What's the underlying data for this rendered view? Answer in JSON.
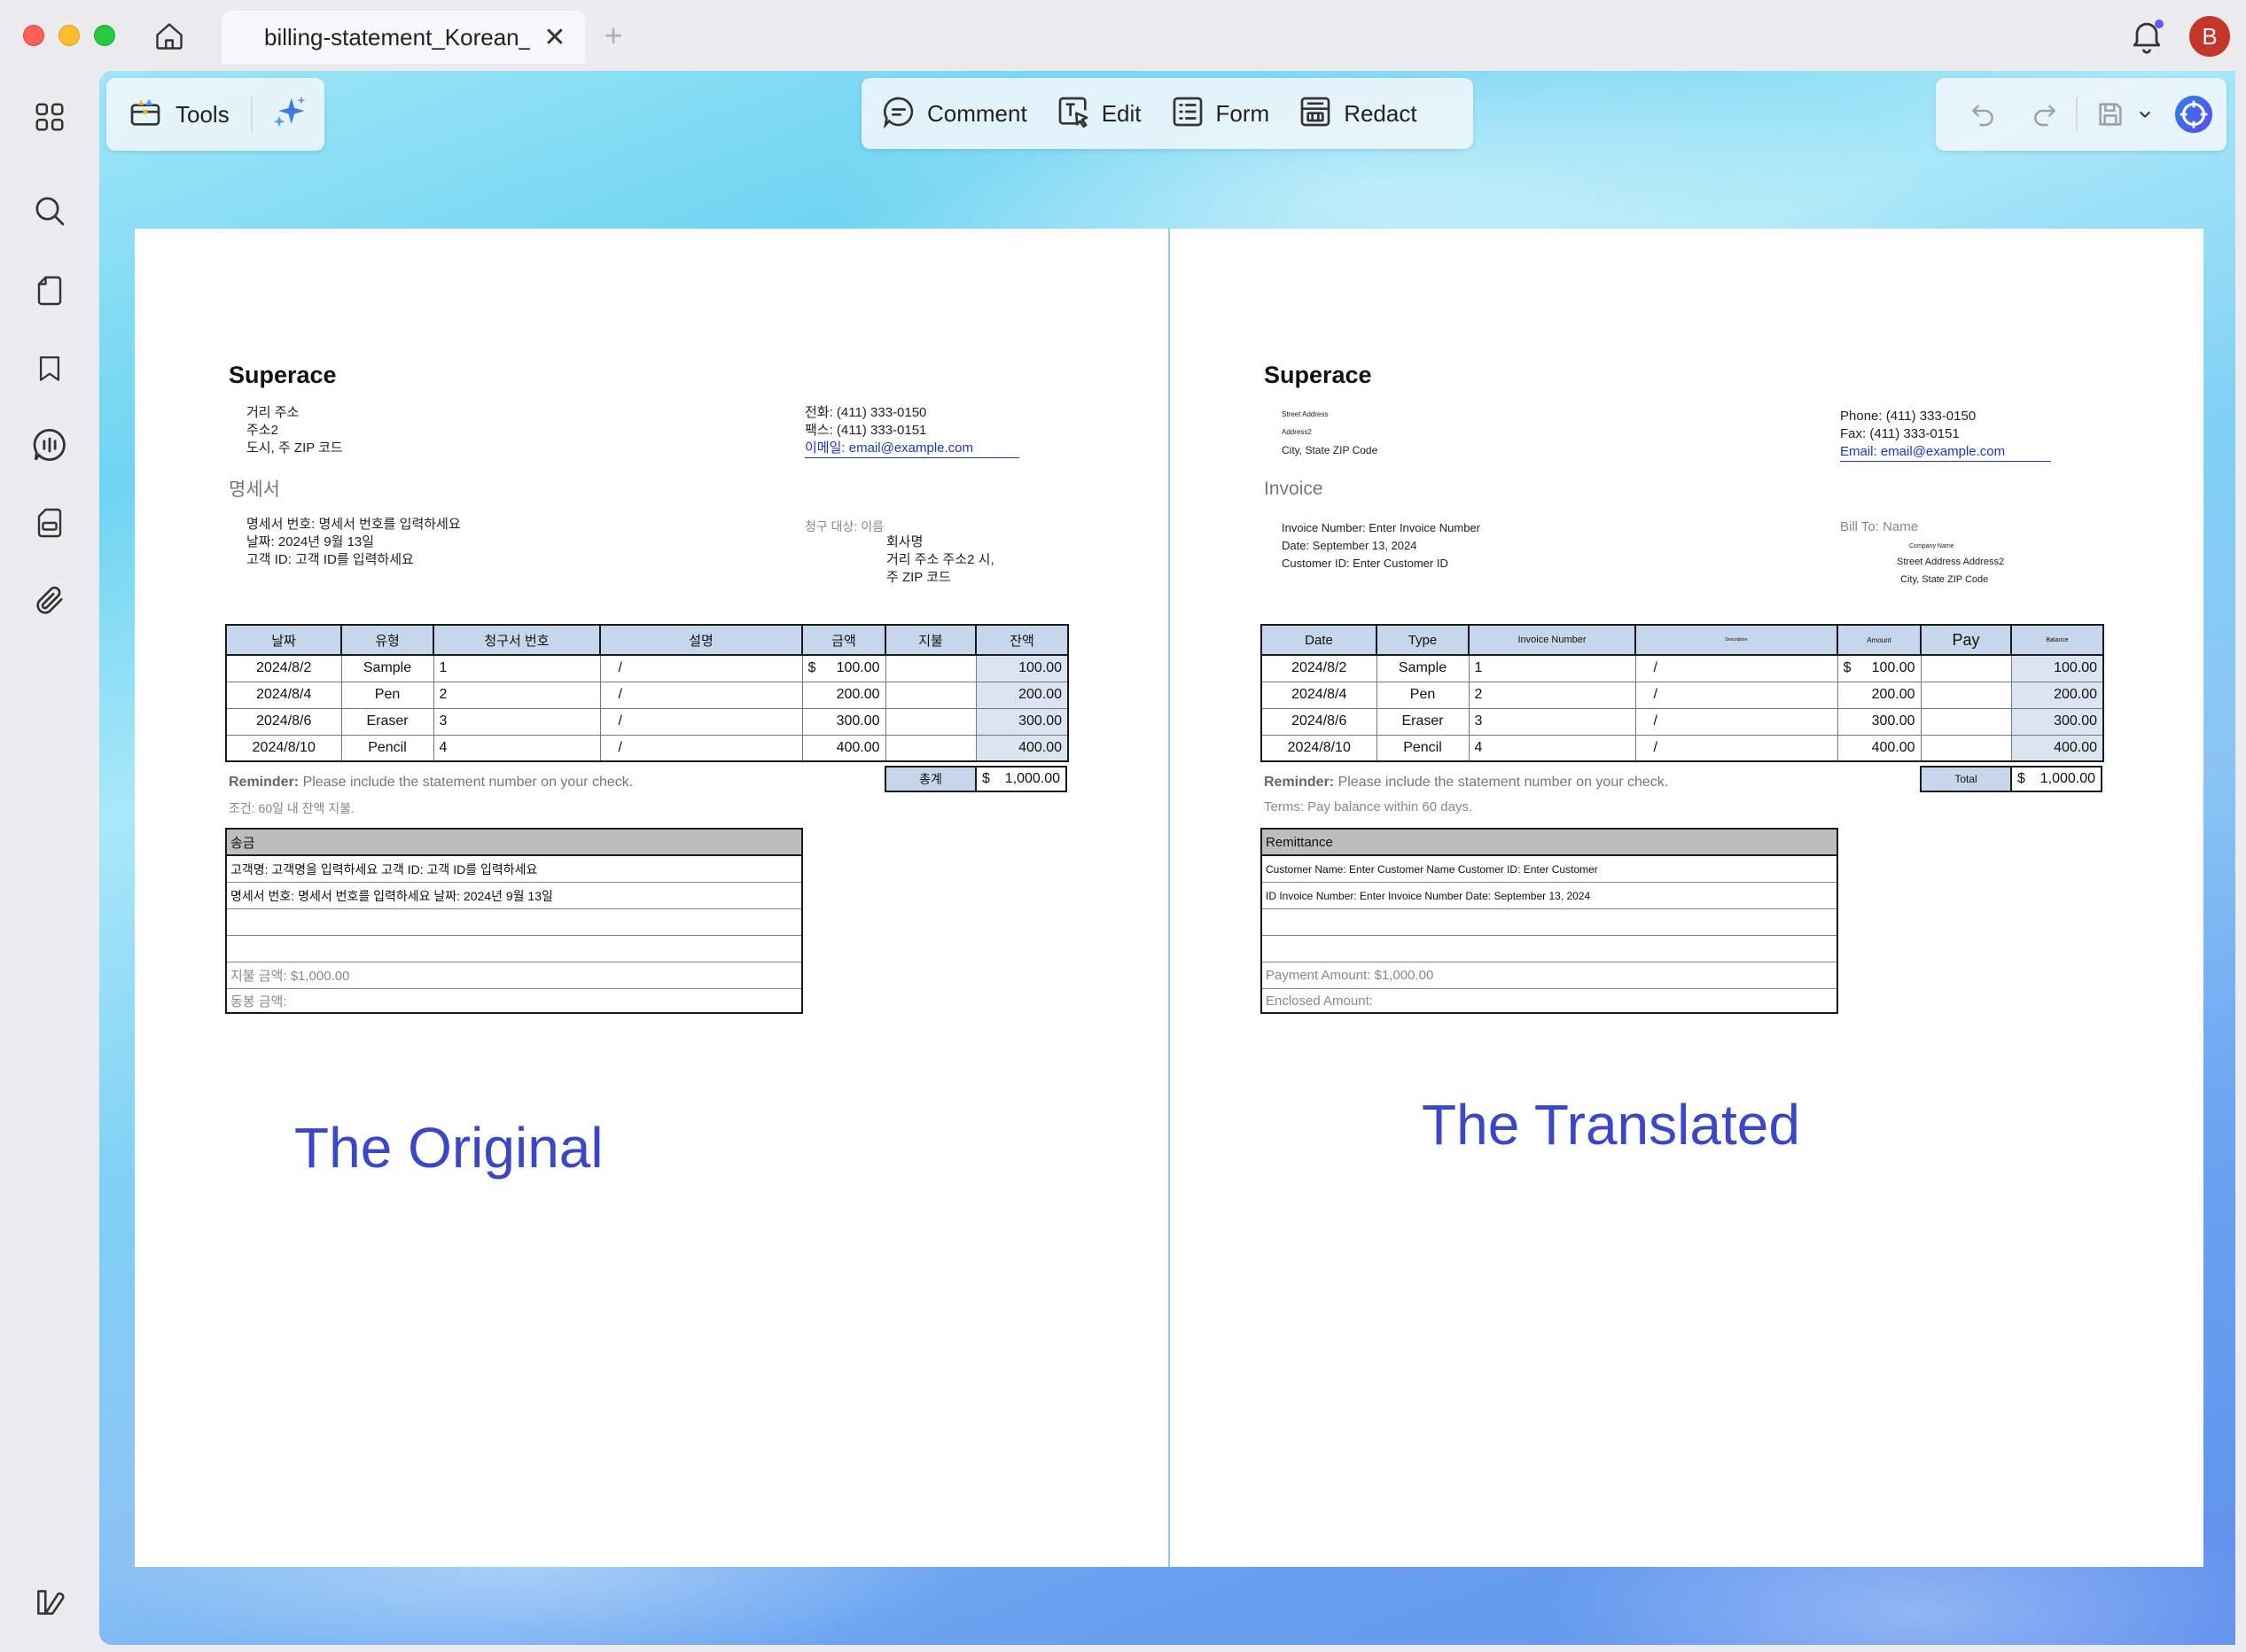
{
  "window": {
    "tab_title": "billing-statement_Korean_",
    "tab_close": "✕",
    "tab_add": "+",
    "avatar_initial": "B"
  },
  "toolbar": {
    "tools_label": "Tools",
    "comment_label": "Comment",
    "edit_label": "Edit",
    "form_label": "Form",
    "redact_label": "Redact"
  },
  "colors": {
    "accent": "#3a47c8",
    "table_header": "#c6d7ec",
    "avatar": "#c4352a",
    "link": "#1a37c9"
  },
  "original": {
    "company": "Superace",
    "address": [
      "거리 주소",
      "주소2",
      "도시, 주 ZIP 코드"
    ],
    "contact": {
      "phone": "전화: (411) 333-0150",
      "fax": "팩스: (411) 333-0151",
      "email_label": "이메일: ",
      "email": "email@example.com"
    },
    "heading": "명세서",
    "meta": [
      "명세서 번호: 명세서 번호를 입력하세요",
      "날짜: 2024년 9월 13일",
      "고객 ID: 고객 ID를 입력하세요"
    ],
    "bill_to_label": "청구 대상: 이름",
    "bill_to": [
      "회사명",
      "거리 주소 주소2 시,",
      "주 ZIP 코드"
    ],
    "headers": [
      "날짜",
      "유형",
      "청구서 번호",
      "설명",
      "금액",
      "지불",
      "잔액"
    ],
    "rows": [
      {
        "date": "2024/8/2",
        "type": "Sample",
        "invoice": "1",
        "desc": "/",
        "cur": "$",
        "amount": "100.00",
        "pay": "",
        "balance": "100.00"
      },
      {
        "date": "2024/8/4",
        "type": "Pen",
        "invoice": "2",
        "desc": "/",
        "cur": "",
        "amount": "200.00",
        "pay": "",
        "balance": "200.00"
      },
      {
        "date": "2024/8/6",
        "type": "Eraser",
        "invoice": "3",
        "desc": "/",
        "cur": "",
        "amount": "300.00",
        "pay": "",
        "balance": "300.00"
      },
      {
        "date": "2024/8/10",
        "type": "Pencil",
        "invoice": "4",
        "desc": "/",
        "cur": "",
        "amount": "400.00",
        "pay": "",
        "balance": "400.00"
      }
    ],
    "total_label": "총계",
    "total_cur": "$",
    "total_value": "1,000.00",
    "reminder_bold": "Reminder:",
    "reminder_text": " Please include the statement number on your check.",
    "terms": "조건: 60일 내 잔액 지불.",
    "remit_title": "송금",
    "remit_rows": [
      "고객명: 고객명을 입력하세요 고객 ID: 고객 ID를 입력하세요",
      "명세서 번호: 명세서 번호를 입력하세요 날짜: 2024년 9월 13일",
      "",
      "",
      "지불 금액: $1,000.00",
      "동봉 금액:"
    ],
    "caption": "The Original"
  },
  "translated": {
    "company": "Superace",
    "address": [
      "Street Address",
      "Address2",
      "City, State ZIP Code"
    ],
    "contact": {
      "phone": "Phone: (411) 333-0150",
      "fax": "Fax: (411) 333-0151",
      "email_label": "Email: ",
      "email": "email@example.com"
    },
    "heading": "Invoice",
    "meta": [
      "Invoice Number: Enter Invoice Number",
      "Date: September 13, 2024",
      "Customer ID: Enter Customer ID"
    ],
    "bill_to_label": "Bill To: Name",
    "bill_to": [
      "Company Name",
      "Street Address Address2",
      "City, State ZIP Code"
    ],
    "headers": [
      "Date",
      "Type",
      "Invoice Number",
      "Description",
      "Amount",
      "Pay",
      "Balance"
    ],
    "rows": [
      {
        "date": "2024/8/2",
        "type": "Sample",
        "invoice": "1",
        "desc": "/",
        "cur": "$",
        "amount": "100.00",
        "pay": "",
        "balance": "100.00"
      },
      {
        "date": "2024/8/4",
        "type": "Pen",
        "invoice": "2",
        "desc": "/",
        "cur": "",
        "amount": "200.00",
        "pay": "",
        "balance": "200.00"
      },
      {
        "date": "2024/8/6",
        "type": "Eraser",
        "invoice": "3",
        "desc": "/",
        "cur": "",
        "amount": "300.00",
        "pay": "",
        "balance": "300.00"
      },
      {
        "date": "2024/8/10",
        "type": "Pencil",
        "invoice": "4",
        "desc": "/",
        "cur": "",
        "amount": "400.00",
        "pay": "",
        "balance": "400.00"
      }
    ],
    "total_label": "Total",
    "total_cur": "$",
    "total_value": "1,000.00",
    "reminder_bold": "Reminder:",
    "reminder_text": " Please include the statement number on your check.",
    "terms": "Terms: Pay balance within 60 days.",
    "remit_title": "Remittance",
    "remit_rows": [
      "Customer Name: Enter Customer Name Customer ID: Enter Customer",
      " ID Invoice Number: Enter Invoice Number Date: September 13, 2024",
      "",
      "",
      "Payment Amount: $1,000.00",
      "Enclosed Amount:"
    ],
    "caption": "The Translated"
  }
}
